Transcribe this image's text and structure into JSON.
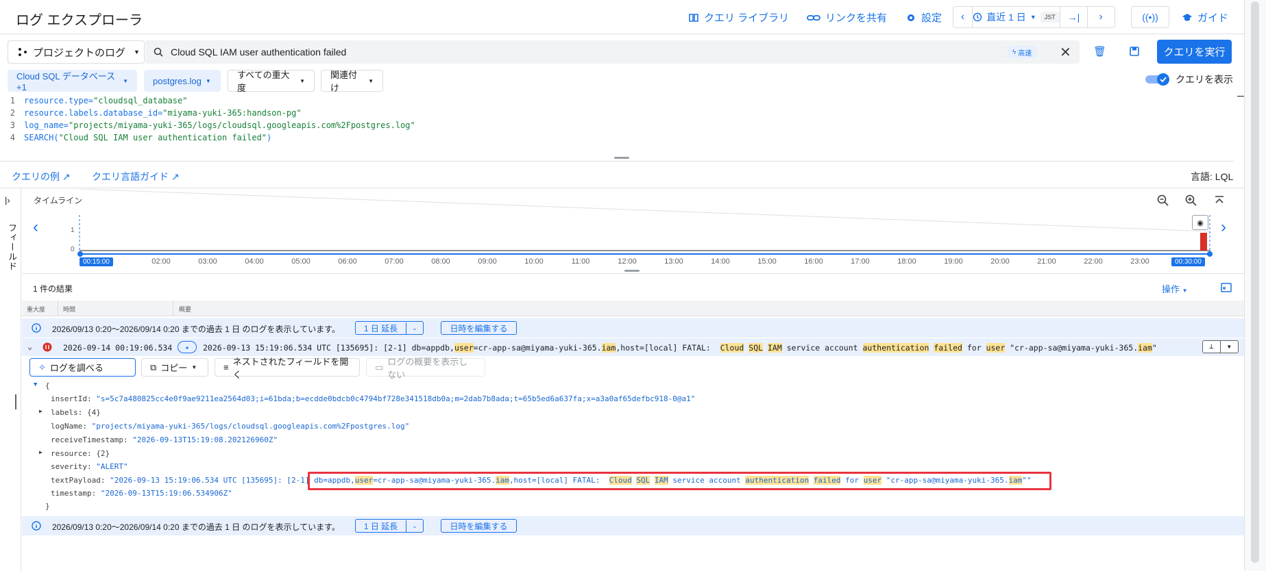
{
  "header": {
    "title": "ログ エクスプローラ",
    "query_library": "クエリ ライブラリ",
    "share_link": "リンクを共有",
    "settings": "設定",
    "time_range": "直近 1 日",
    "timezone": "JST",
    "guide": "ガイド"
  },
  "query": {
    "scope": "プロジェクトのログ",
    "search_value": "Cloud SQL IAM user authentication failed",
    "fast_badge": "高速",
    "run_button": "クエリを実行"
  },
  "filters": {
    "resource": "Cloud SQL データベース +1",
    "log_name": "postgres.log",
    "severity": "すべての重大度",
    "correlate": "関連付け",
    "show_query": "クエリを表示"
  },
  "editor": {
    "lines": [
      {
        "num": "1",
        "key": "resource.type=",
        "val": "\"cloudsql_database\""
      },
      {
        "num": "2",
        "key": "resource.labels.database_id=",
        "val": "\"miyama-yuki-365:handson-pg\""
      },
      {
        "num": "3",
        "key": "log_name=",
        "val": "\"projects/miyama-yuki-365/logs/cloudsql.googleapis.com%2Fpostgres.log\""
      },
      {
        "num": "4",
        "key": "SEARCH(",
        "val": "\"Cloud SQL IAM user authentication failed\"",
        "tail": ")"
      }
    ]
  },
  "links": {
    "examples": "クエリの例",
    "guide": "クエリ言語ガイド",
    "language": "言語: LQL"
  },
  "rail": {
    "label": "フィールド"
  },
  "timeline": {
    "title": "タイムライン",
    "y_labels": [
      "1",
      "0"
    ],
    "start_label": "00:15:00",
    "end_label": "00:30:00",
    "ticks": [
      "02:00",
      "03:00",
      "04:00",
      "05:00",
      "06:00",
      "07:00",
      "08:00",
      "09:00",
      "10:00",
      "11:00",
      "12:00",
      "13:00",
      "14:00",
      "15:00",
      "16:00",
      "17:00",
      "18:00",
      "19:00",
      "20:00",
      "21:00",
      "22:00",
      "23:00"
    ],
    "bar_color": "#d93025"
  },
  "results": {
    "count": "1 件の結果",
    "actions": "操作",
    "columns": [
      "重大度",
      "時間",
      "概要"
    ]
  },
  "banner": {
    "text": "2026/09/13 0:20〜2026/09/14 0:20 までの過去 1 日 のログを表示しています。",
    "extend": "1 日 延長",
    "edit": "日時を編集する"
  },
  "log_entry": {
    "timestamp": "2026-09-14 00:19:06.534",
    "summary_prefix": "2026-09-13 15:19:06.534 UTC [135695]: [2-1] db=appdb,",
    "w_user": "user",
    "summary_mid1": "=cr-app-sa@miyama-yuki-365.",
    "w_iam": "iam",
    "summary_mid2": ",host=[local] FATAL:  ",
    "w_cloud": "Cloud",
    "w_sql": "SQL",
    "w_iam2": "IAM",
    "summary_mid3": "service account",
    "w_auth": "authentication",
    "w_failed": "failed",
    "w_for": "for",
    "summary_mid4": "\"cr-app-sa@miyama-yuki-365.",
    "summary_end": "\"",
    "severity_color": "#d93025"
  },
  "log_actions": {
    "explain": "ログを調べる",
    "copy": "コピー",
    "expand": "ネストされたフィールドを開く",
    "hide_summary": "ログの概要を表示しない"
  },
  "json": {
    "open": "{",
    "close": "}",
    "insertId_key": "insertId",
    "insertId_val": "\"s=5c7a480825cc4e0f9ae9211ea2564d03;i=61bda;b=ecdde0bdcb0c4794bf728e341518db0a;m=2dab7b8ada;t=65b5ed6a637fa;x=a3a0af65defbc918-0@a1\"",
    "labels_key": "labels",
    "labels_val": "{4}",
    "logName_key": "logName",
    "logName_val": "\"projects/miyama-yuki-365/logs/cloudsql.googleapis.com%2Fpostgres.log\"",
    "receive_key": "receiveTimestamp",
    "receive_val": "\"2026-09-13T15:19:08.202126960Z\"",
    "resource_key": "resource",
    "resource_val": "{2}",
    "severity_key": "severity",
    "severity_val": "\"ALERT\"",
    "payload_key": "textPayload",
    "payload_prefix": "\"2026-09-13 15:19:06.534 UTC [135695]: [2-1]",
    "payload_db": "db=appdb,",
    "payload_close": "\"\"",
    "timestamp_key": "timestamp",
    "timestamp_val": "\"2026-09-13T15:19:06.534906Z\""
  },
  "colors": {
    "accent": "#1a73e8",
    "highlight": "#fde293",
    "annotation_box": "#ea3340"
  }
}
